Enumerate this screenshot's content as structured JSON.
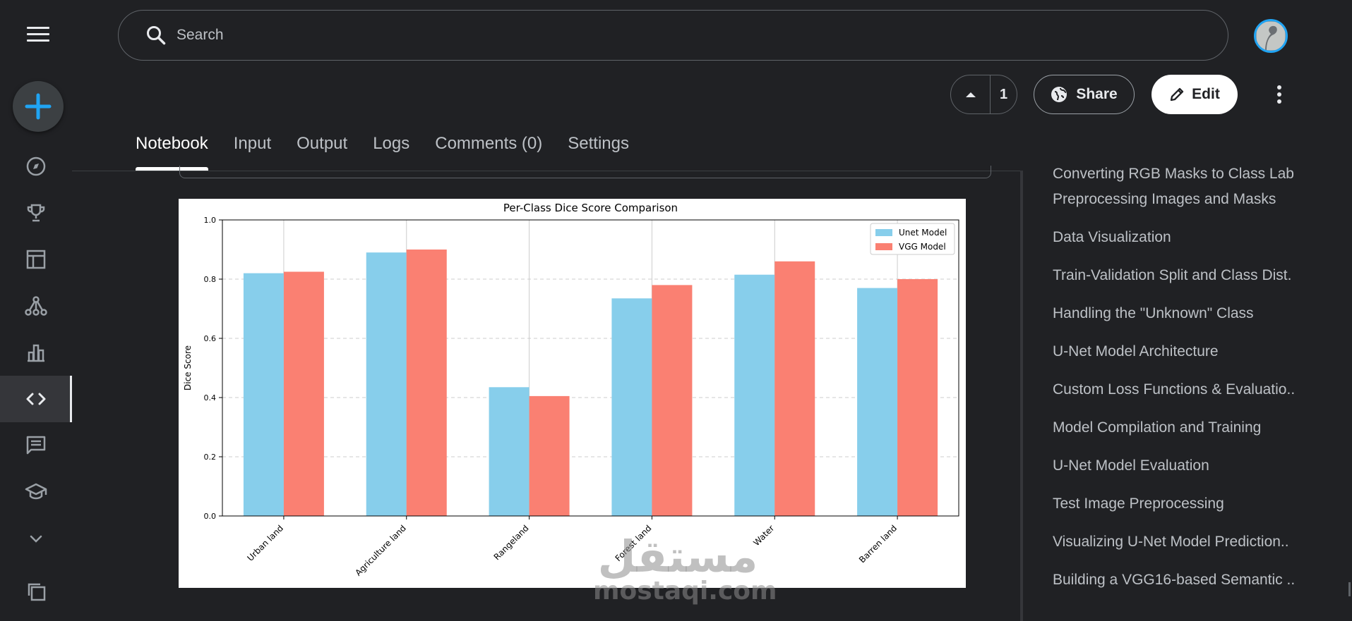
{
  "search": {
    "placeholder": "Search"
  },
  "vote": {
    "count": "1"
  },
  "actions": {
    "share_label": "Share",
    "edit_label": "Edit"
  },
  "tabs": [
    {
      "label": "Notebook"
    },
    {
      "label": "Input"
    },
    {
      "label": "Output"
    },
    {
      "label": "Logs"
    },
    {
      "label": "Comments (0)"
    },
    {
      "label": "Settings"
    }
  ],
  "toc": [
    "Converting RGB Masks to Class Lab",
    "Preprocessing Images and Masks",
    "Data Visualization",
    "Train-Validation Split and Class Dist.",
    "Handling the \"Unknown\" Class",
    "U-Net Model Architecture",
    "Custom Loss Functions & Evaluatio..",
    "Model Compilation and Training",
    "U-Net Model Evaluation",
    "Test Image Preprocessing",
    "Visualizing U-Net Model Prediction..",
    "Building a VGG16-based Semantic .."
  ],
  "sidebar_icons": [
    "compass-icon",
    "trophy-icon",
    "table-icon",
    "models-icon",
    "bar-chart-icon",
    "code-icon",
    "comments-icon",
    "learn-icon",
    "chevron-down-icon",
    "copy-icon"
  ],
  "colors": {
    "accent": "#20a4f3",
    "unet": "#87ceeb",
    "vgg": "#fa8072"
  },
  "chart_data": {
    "type": "bar",
    "title": "Per-Class Dice Score Comparison",
    "xlabel": "",
    "ylabel": "Dice Score",
    "categories": [
      "Urban land",
      "Agriculture land",
      "Rangeland",
      "Forest land",
      "Water",
      "Barren land"
    ],
    "series": [
      {
        "name": "Unet Model",
        "color": "#87ceeb",
        "values": [
          0.82,
          0.89,
          0.435,
          0.735,
          0.815,
          0.77
        ]
      },
      {
        "name": "VGG Model",
        "color": "#fa8072",
        "values": [
          0.825,
          0.9,
          0.405,
          0.78,
          0.86,
          0.8
        ]
      }
    ],
    "ylim": [
      0,
      1.0
    ],
    "yticks": [
      "0.0",
      "0.2",
      "0.4",
      "0.6",
      "0.8",
      "1.0"
    ],
    "grid": "y-dashed",
    "legend": "top-right"
  },
  "watermark": {
    "arabic": "مستقل",
    "latin": "mostaqi.com"
  }
}
